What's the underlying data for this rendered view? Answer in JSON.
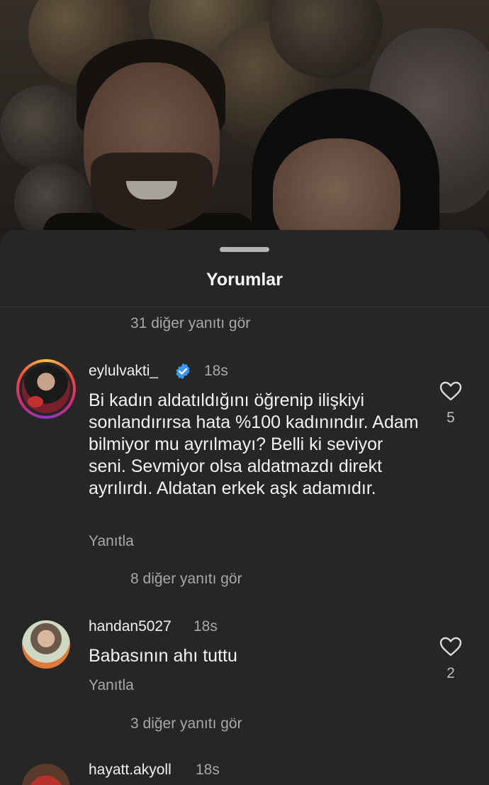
{
  "sheet": {
    "title": "Yorumlar"
  },
  "threads": [
    {
      "more_replies": "31 diğer yanıtı gör"
    }
  ],
  "comments": [
    {
      "username": "eylulvakti_",
      "verified": true,
      "time": "18s",
      "text": "Bi kadın aldatıldığını öğrenip ilişkiyi sonlandırırsa hata %100 kadınındır. Adam bilmiyor mu ayrılmayı? Belli ki seviyor seni. Sevmiyor olsa aldatmazdı direkt ayrılırdı. Aldatan erkek aşk adamıdır.",
      "reply_label": "Yanıtla",
      "likes": "5",
      "more_replies": "8 diğer yanıtı gör"
    },
    {
      "username": "handan5027",
      "verified": false,
      "time": "18s",
      "text": "Babasının ahı tuttu",
      "reply_label": "Yanıtla",
      "likes": "2",
      "more_replies": "3 diğer yanıtı gör"
    },
    {
      "username": "hayatt.akyoll",
      "verified": false,
      "time": "18s"
    }
  ],
  "colors": {
    "sheet_bg": "#262626",
    "muted_text": "#a8a8a8",
    "verified_blue": "#3897f0"
  }
}
